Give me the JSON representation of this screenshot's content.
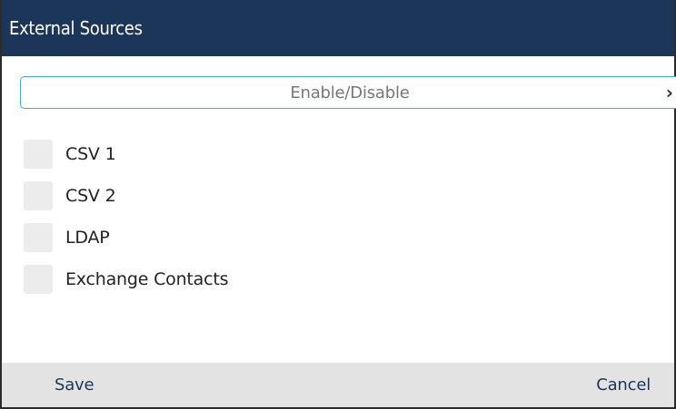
{
  "header": {
    "title": "External Sources"
  },
  "enable_row": {
    "label": "Enable/Disable",
    "chevron": "›"
  },
  "sources": [
    {
      "label": "CSV 1",
      "checked": false
    },
    {
      "label": "CSV 2",
      "checked": false
    },
    {
      "label": "LDAP",
      "checked": false
    },
    {
      "label": "Exchange Contacts",
      "checked": false
    }
  ],
  "footer": {
    "save_label": "Save",
    "cancel_label": "Cancel"
  },
  "colors": {
    "title_bar": "#1b3658",
    "accent_border": "#3fa8dc",
    "footer_bg": "#e3e3e3",
    "checkbox_bg": "#ececec"
  }
}
